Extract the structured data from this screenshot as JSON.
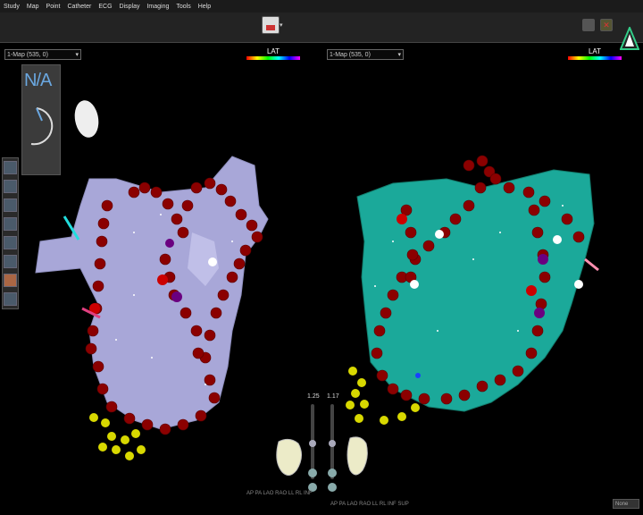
{
  "menu": [
    "Study",
    "Map",
    "Point",
    "Catheter",
    "ECG",
    "Display",
    "Imaging",
    "Tools",
    "Help"
  ],
  "left_view": {
    "map_select": "1-Map (535, 0)",
    "legend": "LAT",
    "na_label": "N/A",
    "axes": "AP  PA  LAO  RAO  LL  RL  INF",
    "zoom": "1.25"
  },
  "right_view": {
    "map_select": "1-Map (535, 0)",
    "legend": "LAT",
    "axes": "AP  PA  LAO  RAO  LL  RL  INF  SUP",
    "zoom": "1.17"
  },
  "view_select": "None",
  "colors": {
    "left_chamber": "#a8a7d8",
    "right_chamber": "#1ba99a",
    "ablation_point": "#8b0000",
    "tag_yellow": "#d8d800"
  }
}
